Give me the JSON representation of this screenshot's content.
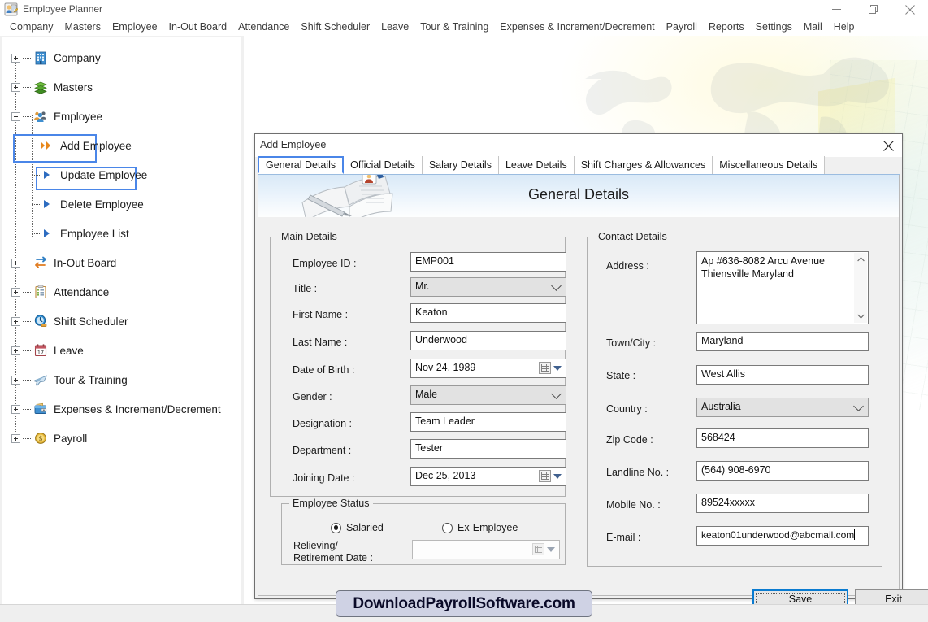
{
  "window": {
    "title": "Employee Planner",
    "icon": "employee-planner-icon",
    "minimize_label": "—",
    "maximize_label": "❐",
    "close_label": "✕"
  },
  "menubar": {
    "items": [
      "Company",
      "Masters",
      "Employee",
      "In-Out Board",
      "Attendance",
      "Shift Scheduler",
      "Leave",
      "Tour & Training",
      "Expenses & Increment/Decrement",
      "Payroll",
      "Reports",
      "Settings",
      "Mail",
      "Help"
    ]
  },
  "sidebar": {
    "nodes": [
      {
        "label": "Company",
        "icon": "building-icon",
        "expander": "plus",
        "level": 0,
        "selected": false
      },
      {
        "label": "Masters",
        "icon": "layers-icon",
        "expander": "plus",
        "level": 0,
        "selected": false
      },
      {
        "label": "Employee",
        "icon": "people-icon",
        "expander": "minus",
        "level": 0,
        "selected": true
      },
      {
        "label": "Add Employee",
        "icon": "double-arrow-orange-icon",
        "expander": "none",
        "level": 1,
        "selected": true
      },
      {
        "label": "Update Employee",
        "icon": "arrow-blue-icon",
        "expander": "none",
        "level": 1,
        "selected": false
      },
      {
        "label": "Delete Employee",
        "icon": "arrow-blue-icon",
        "expander": "none",
        "level": 1,
        "selected": false
      },
      {
        "label": "Employee List",
        "icon": "arrow-blue-icon",
        "expander": "none",
        "level": 1,
        "selected": false
      },
      {
        "label": "In-Out Board",
        "icon": "in-out-arrows-icon",
        "expander": "plus",
        "level": 0,
        "selected": false
      },
      {
        "label": "Attendance",
        "icon": "clipboard-icon",
        "expander": "plus",
        "level": 0,
        "selected": false
      },
      {
        "label": "Shift Scheduler",
        "icon": "clock-icon",
        "expander": "plus",
        "level": 0,
        "selected": false
      },
      {
        "label": "Leave",
        "icon": "calendar-17-icon",
        "expander": "plus",
        "level": 0,
        "selected": false
      },
      {
        "label": "Tour & Training",
        "icon": "airplane-icon",
        "expander": "plus",
        "level": 0,
        "selected": false
      },
      {
        "label": "Expenses & Increment/Decrement",
        "icon": "wallet-icon",
        "expander": "plus",
        "level": 0,
        "selected": false
      },
      {
        "label": "Payroll",
        "icon": "coin-dollar-icon",
        "expander": "plus",
        "level": 0,
        "selected": false
      }
    ]
  },
  "dialog": {
    "title": "Add Employee",
    "close_label": "✕",
    "tabs": [
      {
        "label": "General Details",
        "active": true
      },
      {
        "label": "Official Details",
        "active": false
      },
      {
        "label": "Salary Details",
        "active": false
      },
      {
        "label": "Leave Details",
        "active": false
      },
      {
        "label": "Shift Charges & Allowances",
        "active": false
      },
      {
        "label": "Miscellaneous Details",
        "active": false
      }
    ],
    "banner_title": "General Details",
    "main_details": {
      "legend": "Main Details",
      "fields": {
        "employee_id": {
          "label": "Employee ID :",
          "value": "EMP001"
        },
        "title": {
          "label": "Title :",
          "value": "Mr."
        },
        "first_name": {
          "label": "First Name :",
          "value": "Keaton"
        },
        "last_name": {
          "label": "Last Name :",
          "value": "Underwood"
        },
        "date_of_birth": {
          "label": "Date of Birth :",
          "value": "Nov 24, 1989"
        },
        "gender": {
          "label": "Gender :",
          "value": "Male"
        },
        "designation": {
          "label": "Designation :",
          "value": "Team Leader"
        },
        "department": {
          "label": "Department :",
          "value": "Tester"
        },
        "joining_date": {
          "label": "Joining Date :",
          "value": "Dec 25, 2013"
        }
      }
    },
    "employee_status": {
      "legend": "Employee Status",
      "salaried": {
        "label": "Salaried",
        "checked": true
      },
      "ex_employee": {
        "label": "Ex-Employee",
        "checked": false
      },
      "relieving_date": {
        "label_line1": "Relieving/",
        "label_line2": "Retirement Date :",
        "value": ""
      }
    },
    "contact_details": {
      "legend": "Contact Details",
      "fields": {
        "address": {
          "label": "Address :",
          "value": "Ap #636-8082 Arcu Avenue\nThiensville Maryland"
        },
        "town_city": {
          "label": "Town/City :",
          "value": "Maryland"
        },
        "state": {
          "label": "State :",
          "value": "West Allis"
        },
        "country": {
          "label": "Country :",
          "value": "Australia"
        },
        "zip_code": {
          "label": "Zip Code :",
          "value": "568424"
        },
        "landline": {
          "label": "Landline No. :",
          "value": "(564) 908-6970"
        },
        "mobile": {
          "label": "Mobile No. :",
          "value": "89524xxxxx"
        },
        "email": {
          "label": "E-mail :",
          "value": "keaton01underwood@abcmail.com"
        }
      }
    },
    "buttons": {
      "save": "Save",
      "exit": "Exit"
    }
  },
  "watermark": {
    "text": "DownloadPayrollSoftware.com"
  },
  "colors": {
    "selection_blue": "#4a86e8",
    "focus_blue": "#0a7bd0",
    "banner_blue": "#d9e9f7",
    "accent_orange": "#e8871a"
  }
}
